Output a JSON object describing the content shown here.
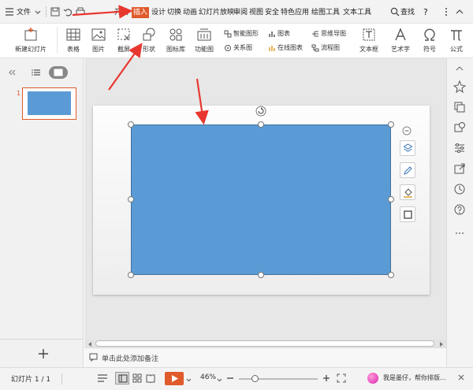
{
  "menu": {
    "file": "文件",
    "tabs": [
      "开始",
      "插入",
      "设计",
      "切换",
      "动画",
      "幻灯片放映",
      "审阅",
      "视图",
      "安全",
      "特色应用",
      "绘图工具",
      "文本工具"
    ],
    "active_tab": "插入",
    "search": "查找",
    "help": "?"
  },
  "ribbon": {
    "new_slide": "新建幻灯片",
    "table": "表格",
    "image": "图片",
    "screenshot": "截屏",
    "shapes": "形状",
    "icon_lib": "图标库",
    "func_chart": "功能图",
    "smart_art": "智能图形",
    "chart": "图表",
    "mind_map": "思维导图",
    "relation": "关系图",
    "online_chart": "在线图表",
    "flowchart": "流程图",
    "textbox": "文本框",
    "wordart": "艺术字",
    "symbol": "符号",
    "formula": "公式"
  },
  "panel": {
    "slide_number": "1"
  },
  "notes": {
    "placeholder": "单击此处添加备注"
  },
  "status": {
    "slide_info": "幻灯片 1 / 1",
    "zoom": "46%",
    "assistant": "我是墨仔，帮你排版..."
  },
  "colors": {
    "accent": "#e05a2b",
    "shape_fill": "#5b9bd5",
    "arrow": "#e8372f"
  }
}
